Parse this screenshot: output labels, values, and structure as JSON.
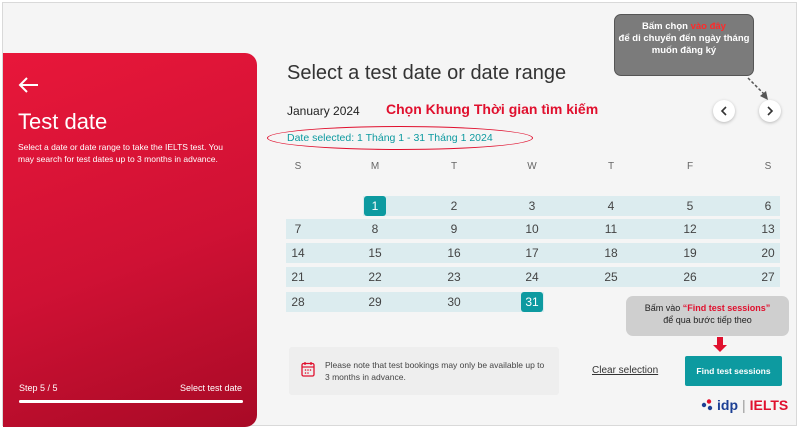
{
  "left_panel": {
    "title": "Test date",
    "description": "Select a date or date range to take the IELTS test. You may search for test dates up to 3 months in advance.",
    "step": "Step 5 / 5",
    "step_label": "Select test date",
    "progress": 1.0
  },
  "main": {
    "title": "Select a test date or date range",
    "month_label": "January 2024",
    "date_selected": "Date selected: 1 Tháng 1 - 31 Tháng 1 2024",
    "weekdays": [
      "S",
      "M",
      "T",
      "W",
      "T",
      "F",
      "S"
    ],
    "weeks": [
      [
        "",
        "1",
        "2",
        "3",
        "4",
        "5",
        "6"
      ],
      [
        "7",
        "8",
        "9",
        "10",
        "11",
        "12",
        "13"
      ],
      [
        "14",
        "15",
        "16",
        "17",
        "18",
        "19",
        "20"
      ],
      [
        "21",
        "22",
        "23",
        "24",
        "25",
        "26",
        "27"
      ],
      [
        "28",
        "29",
        "30",
        "31",
        "",
        "",
        ""
      ]
    ],
    "selected_start": "1",
    "selected_end": "31",
    "notice": "Please note that test bookings may only be available up to 3 months in advance.",
    "clear_label": "Clear selection",
    "find_label": "Find test sessions"
  },
  "annotations": {
    "search_range": "Chọn Khung Thời gian tìm kiếm",
    "top_callout_pre": "Bấm chọn ",
    "top_callout_highlight": "vào đây",
    "top_callout_post": "để di chuyển đến ngày tháng muốn đăng ký",
    "bottom_callout_pre": "Bấm vào ",
    "bottom_callout_highlight": "“Find test sessions”",
    "bottom_callout_post": "để qua bước tiếp theo"
  },
  "logo": {
    "idp": "idp",
    "ielts": "IELTS"
  },
  "colors": {
    "brand_red": "#e0102e",
    "teal": "#0d9aa0",
    "range_band": "#dcecef"
  }
}
